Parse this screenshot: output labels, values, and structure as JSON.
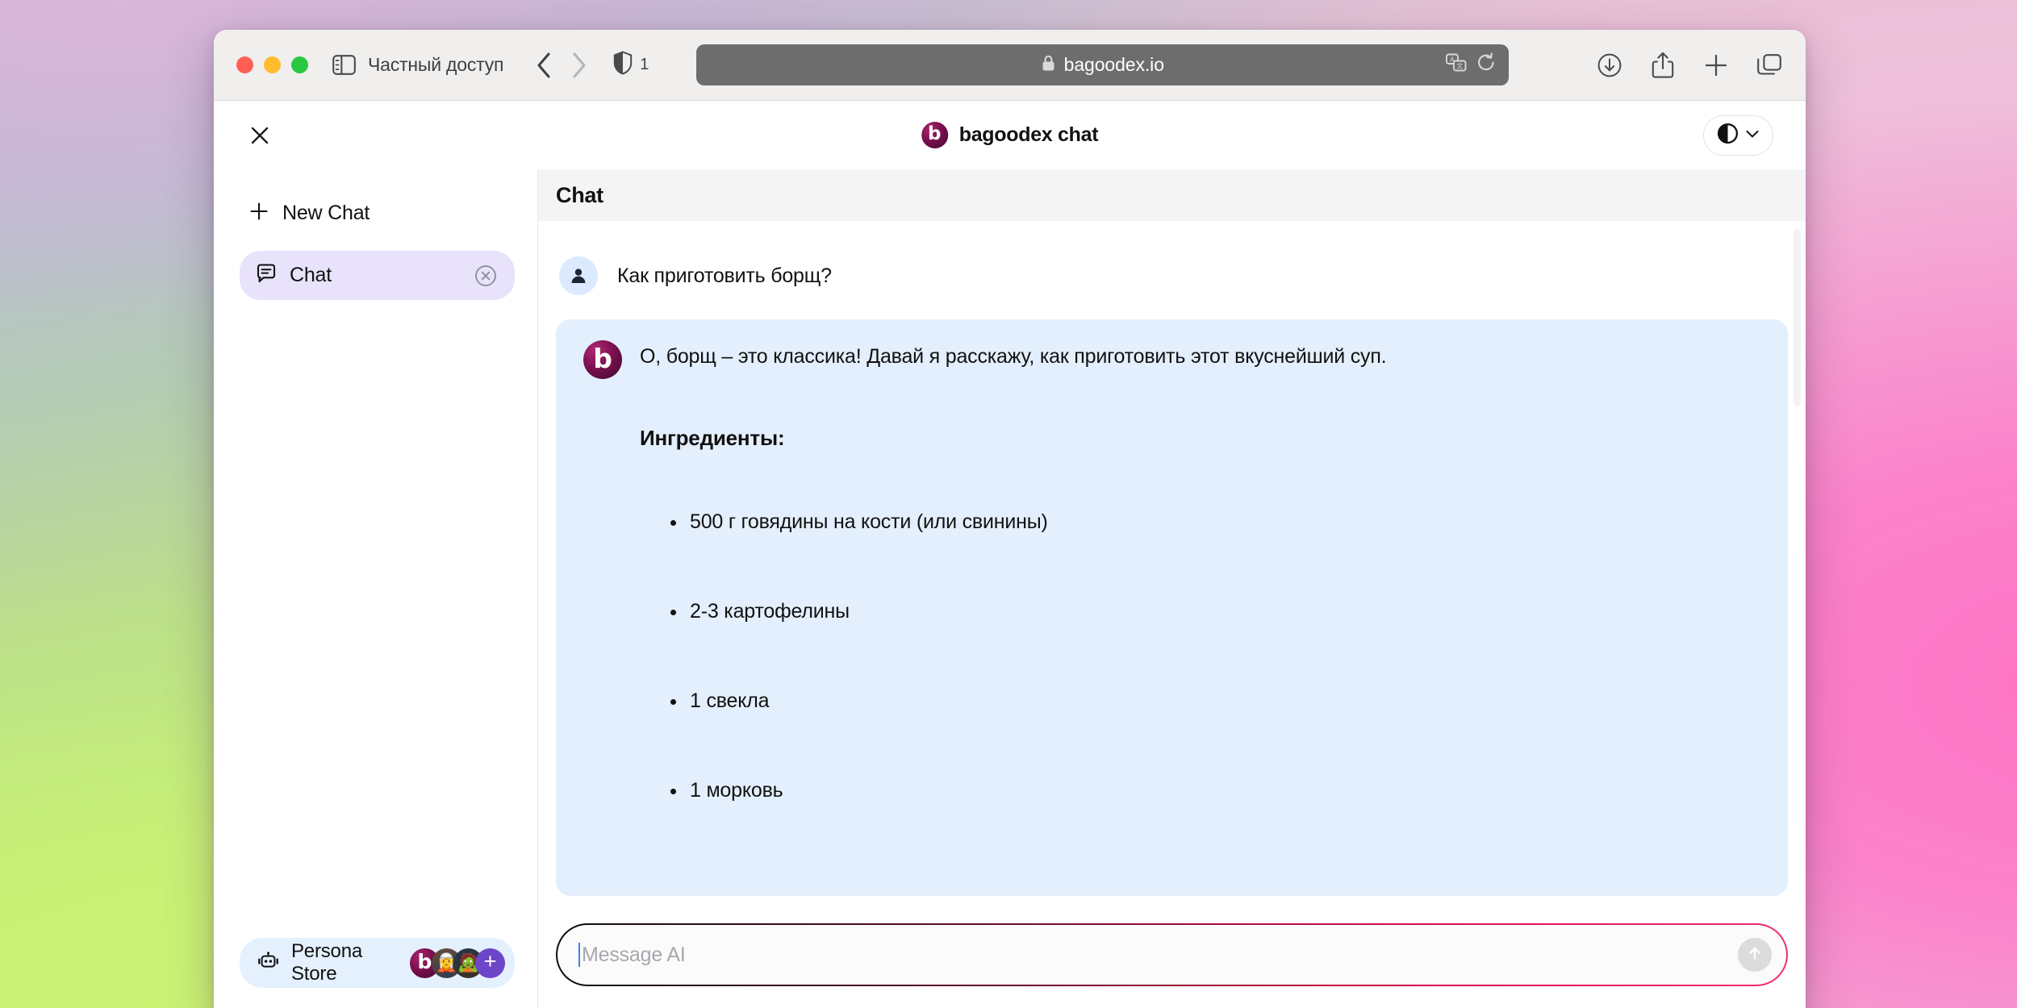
{
  "browser": {
    "traffic_lights": [
      "close",
      "minimize",
      "maximize"
    ],
    "sidebar_toggle_icon": "sidebar-icon",
    "private_mode_label": "Частный доступ",
    "back_icon": "chevron-left-icon",
    "forward_icon": "chevron-right-icon",
    "shield_icon": "shield-icon",
    "tracker_count": "1",
    "address": {
      "lock_icon": "lock-icon",
      "url": "bagoodex.io",
      "translate_icon": "translate-icon",
      "reload_icon": "reload-icon"
    },
    "toolbar_icons": [
      {
        "name": "downloads-icon",
        "label": "Downloads"
      },
      {
        "name": "share-icon",
        "label": "Share"
      },
      {
        "name": "new-tab-icon",
        "label": "New Tab"
      },
      {
        "name": "tab-overview-icon",
        "label": "Tab Overview"
      }
    ]
  },
  "app": {
    "close_icon": "close-icon",
    "brand": {
      "logo_letter": "b",
      "title": "bagoodex chat",
      "logo_color": "#7d1050"
    },
    "theme_toggle": {
      "icon": "contrast-icon",
      "chevron": "chevron-down-icon"
    }
  },
  "sidebar": {
    "new_chat": {
      "icon": "plus-icon",
      "label": "New Chat"
    },
    "chats": [
      {
        "icon": "chat-bubble-icon",
        "label": "Chat",
        "active": true,
        "close_icon": "close-circle-icon"
      }
    ],
    "persona_store": {
      "icon": "robot-icon",
      "label": "Persona Store",
      "avatars": [
        {
          "name": "bagoodex-avatar",
          "glyph": "b"
        },
        {
          "name": "persona-avatar-1",
          "glyph": "🧝"
        },
        {
          "name": "persona-avatar-2",
          "glyph": "🧟"
        },
        {
          "name": "add-persona-avatar",
          "glyph": "+"
        }
      ]
    }
  },
  "chat": {
    "title": "Chat",
    "messages": [
      {
        "role": "user",
        "avatar_icon": "person-icon",
        "text": "Как приготовить борщ?"
      },
      {
        "role": "assistant",
        "avatar_icon": "bagoodex-logo-icon",
        "intro": "О, борщ – это классика! Давай я расскажу, как приготовить этот вкуснейший суп.",
        "heading": "Ингредиенты:",
        "ingredients": [
          "500 г говядины на кости (или свинины)",
          "2-3 картофелины",
          "1 свекла",
          "1 морковь"
        ]
      }
    ]
  },
  "composer": {
    "placeholder": "Message AI",
    "value": "",
    "send_icon": "arrow-up-icon",
    "border_gradient_start": "#0d0d0f",
    "border_gradient_end": "#f0306f"
  }
}
